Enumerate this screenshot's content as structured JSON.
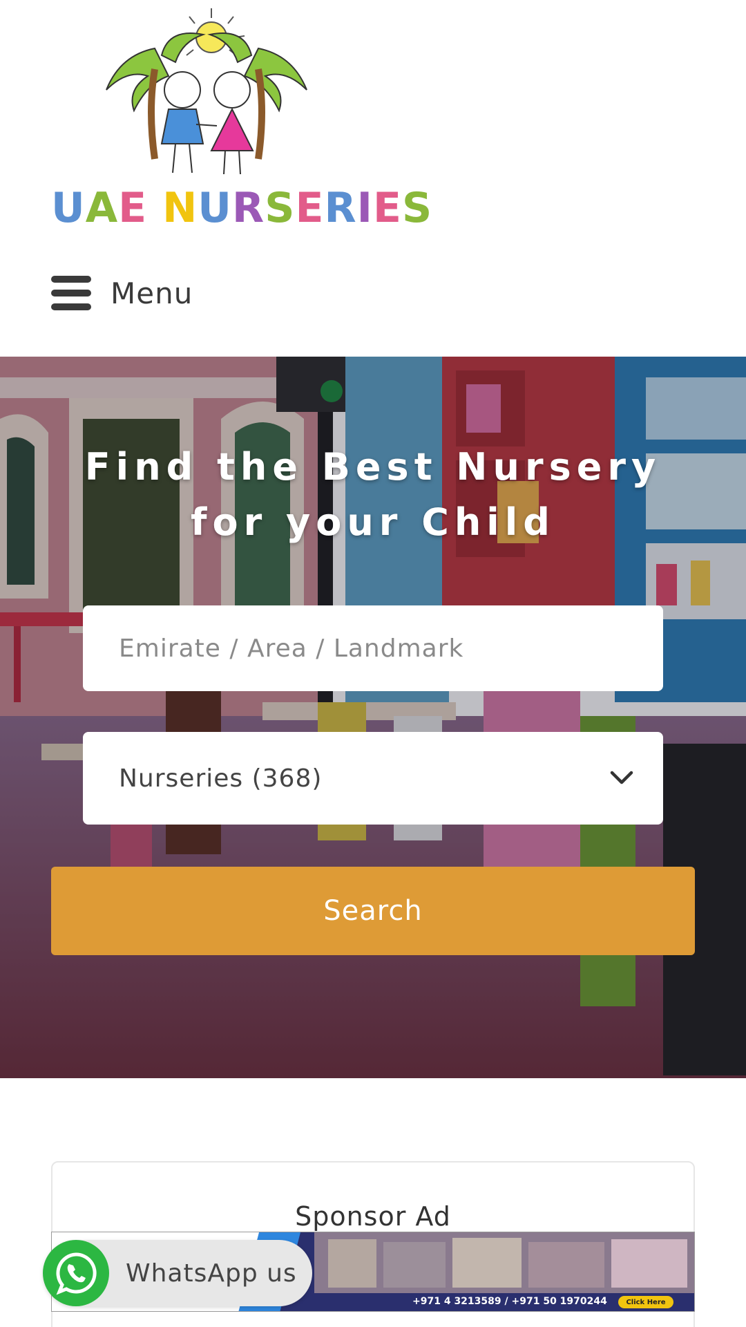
{
  "brand": {
    "logo_text": "UAE NURSERIES",
    "logo_letter_colors": [
      "#5b8fd1",
      "#8ab83a",
      "#e25c8a",
      "#f1c40f",
      "#5b8fd1",
      "#9b59b6",
      "#8ab83a",
      "#e25c8a",
      "#5b8fd1",
      "#9b59b6",
      "#e25c8a",
      "#8ab83a",
      "#e25c8a"
    ]
  },
  "header": {
    "menu_label": "Menu"
  },
  "hero": {
    "title": "Find the Best Nursery for your Child",
    "search_placeholder": "Emirate / Area / Landmark",
    "category_selected": "Nurseries (368)",
    "search_button": "Search"
  },
  "sponsor": {
    "title": "Sponsor Ad",
    "banner_phone": "+971 4 3213589 / +971 50 1970244",
    "banner_cta": "Click Here"
  },
  "whatsapp": {
    "label": "WhatsApp us"
  },
  "colors": {
    "accent": "#de9b36",
    "whatsapp": "#2cb742",
    "text": "#3a3a3a"
  }
}
